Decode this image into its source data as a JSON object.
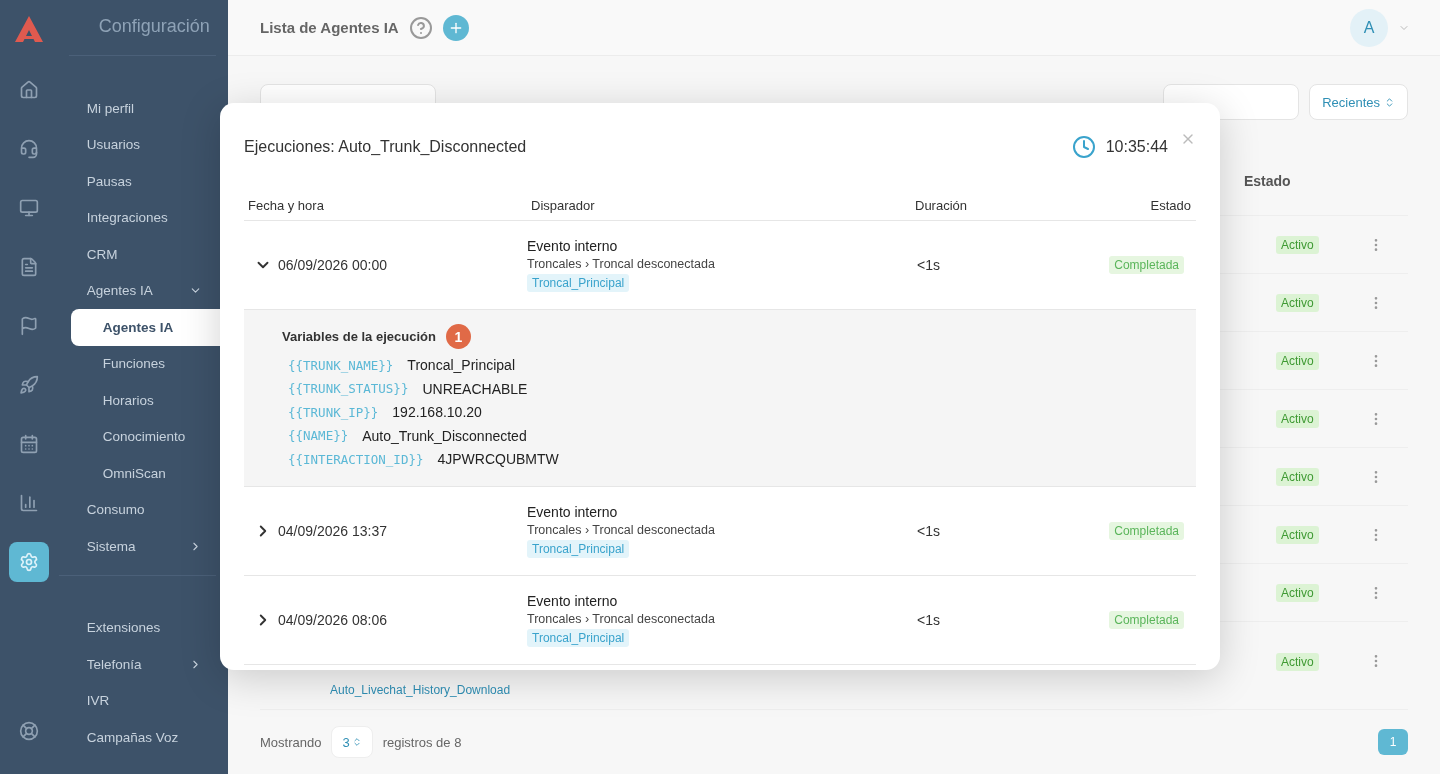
{
  "rail": [
    {
      "selected": false
    },
    {
      "selected": false
    },
    {
      "selected": false
    },
    {
      "selected": false
    },
    {
      "selected": false
    },
    {
      "selected": false
    },
    {
      "selected": false
    },
    {
      "selected": false
    },
    {
      "selected": true
    },
    {
      "selected": false
    }
  ],
  "sidebar": {
    "title": "Configuración",
    "sections": [
      {
        "items": [
          {
            "label": "Mi perfil",
            "selected": false
          },
          {
            "label": "Usuarios",
            "selected": false
          },
          {
            "label": "Pausas",
            "selected": false
          },
          {
            "label": "Integraciones",
            "selected": false
          },
          {
            "label": "CRM",
            "selected": false
          },
          {
            "label": "Agentes IA",
            "selected": false,
            "expanded": true,
            "children": [
              {
                "label": "Agentes IA",
                "selected": true
              },
              {
                "label": "Funciones",
                "selected": false
              },
              {
                "label": "Horarios",
                "selected": false
              },
              {
                "label": "Conocimiento",
                "selected": false
              },
              {
                "label": "OmniScan",
                "selected": false
              }
            ]
          },
          {
            "label": "Consumo",
            "selected": false
          },
          {
            "label": "Sistema",
            "selected": false,
            "expanded": false
          }
        ]
      },
      {
        "items": [
          {
            "label": "Extensiones",
            "selected": false
          },
          {
            "label": "Telefonía",
            "selected": false,
            "expanded": false
          },
          {
            "label": "IVR",
            "selected": false
          },
          {
            "label": "Campañas Voz",
            "selected": false
          }
        ]
      }
    ]
  },
  "topbar": {
    "title": "Lista de Agentes IA",
    "avatar": "A"
  },
  "toolbar": {
    "filters": [
      "Recientes"
    ]
  },
  "table": {
    "status_column": "Estado",
    "rows": [
      {
        "status": "Activo"
      },
      {
        "status": "Activo"
      },
      {
        "status": "Activo"
      },
      {
        "status": "Activo"
      },
      {
        "status": "Activo"
      },
      {
        "status": "Activo"
      },
      {
        "status": "Activo"
      },
      {
        "name": "Auto_Livechat_History_Download",
        "status": "Activo"
      }
    ]
  },
  "footer": {
    "showing": "Mostrando",
    "page_size": "3",
    "records": "registros de 8",
    "pages": [
      {
        "label": "1",
        "selected": true
      }
    ]
  },
  "modal": {
    "title": "Ejecuciones: Auto_Trunk_Disconnected",
    "time": "10:35:44",
    "columns": [
      "Fecha y hora",
      "Disparador",
      "Duración",
      "Estado"
    ],
    "executions": [
      {
        "datetime": "06/09/2026 00:00",
        "trigger": "Evento interno",
        "path": "Troncales › Troncal desconectada",
        "tag": "Troncal_Principal",
        "duration": "<1s",
        "status": "Completada",
        "expanded": true,
        "variables": {
          "title": "Variables de la ejecución",
          "badge": "1",
          "items": [
            {
              "key": "{{TRUNK_NAME}}",
              "value": "Troncal_Principal"
            },
            {
              "key": "{{TRUNK_STATUS}}",
              "value": "UNREACHABLE"
            },
            {
              "key": "{{TRUNK_IP}}",
              "value": "192.168.10.20"
            },
            {
              "key": "{{NAME}}",
              "value": "Auto_Trunk_Disconnected"
            },
            {
              "key": "{{INTERACTION_ID}}",
              "value": "4JPWRCQUBMTW"
            }
          ]
        }
      },
      {
        "datetime": "04/09/2026 13:37",
        "trigger": "Evento interno",
        "path": "Troncales › Troncal desconectada",
        "tag": "Troncal_Principal",
        "duration": "<1s",
        "status": "Completada",
        "expanded": false
      },
      {
        "datetime": "04/09/2026 08:06",
        "trigger": "Evento interno",
        "path": "Troncales › Troncal desconectada",
        "tag": "Troncal_Principal",
        "duration": "<1s",
        "status": "Completada",
        "expanded": false
      }
    ]
  }
}
